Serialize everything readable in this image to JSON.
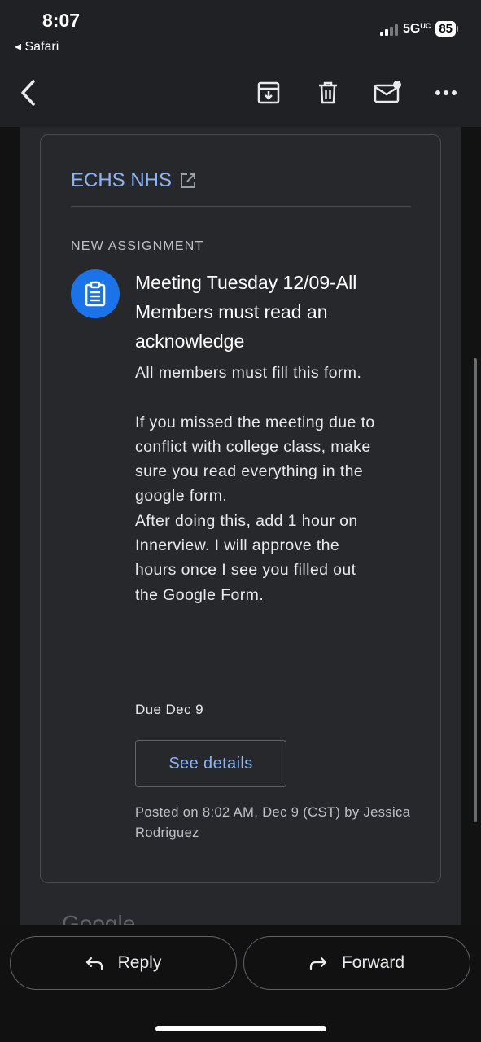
{
  "status_bar": {
    "time": "8:07",
    "back_app": "◂ Safari",
    "network": "5G",
    "network_suffix": "UC",
    "battery": "85"
  },
  "toolbar": {
    "icons": [
      "back-chevron-icon",
      "archive-icon",
      "trash-icon",
      "mark-unread-icon",
      "more-icon"
    ]
  },
  "card": {
    "class_name": "ECHS NHS",
    "section_label": "NEW ASSIGNMENT",
    "title": "Meeting Tuesday 12/09-All Members must read an acknowledge",
    "body": {
      "p1": "All members must fill this form.",
      "p2": "If you missed the meeting due to conflict with college class, make sure you read everything in the google form.",
      "p3": "After doing this, add 1 hour on Innerview. I will approve the hours once I see you filled out the Google Form."
    },
    "due": "Due Dec 9",
    "details_button": "See details",
    "posted": "Posted on 8:02 AM, Dec 9 (CST) by Jessica Rodriguez"
  },
  "footer_partial": "Google",
  "actions": {
    "reply": "Reply",
    "forward": "Forward"
  }
}
